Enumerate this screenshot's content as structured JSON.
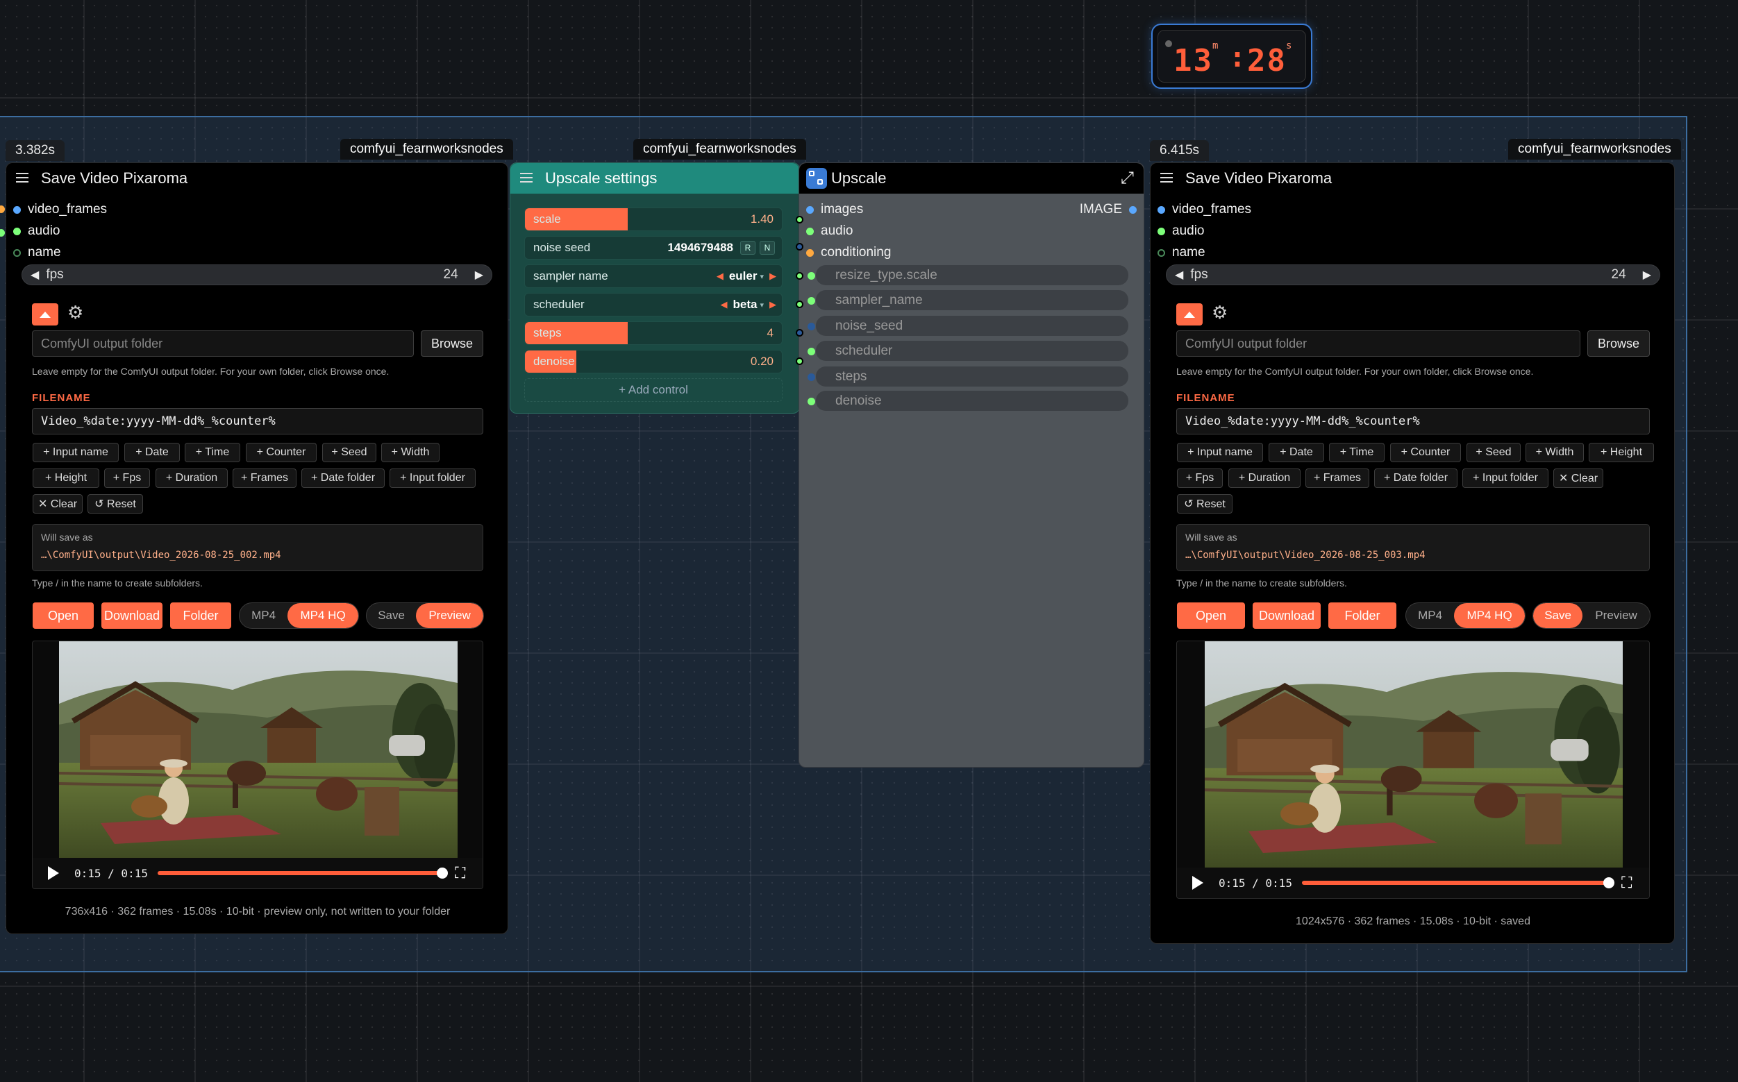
{
  "timer": {
    "minutes": "13",
    "min_unit": "m",
    "seconds": "28",
    "sec_unit": "s"
  },
  "left_node": {
    "time_badge": "3.382s",
    "source_badge": "comfyui_fearnworksnodes",
    "title": "Save Video Pixaroma",
    "inputs": [
      "video_frames",
      "audio",
      "name"
    ],
    "fps_label": "fps",
    "fps_value": "24",
    "folder_placeholder": "ComfyUI output folder",
    "browse_label": "Browse",
    "folder_hint": "Leave empty for the ComfyUI output folder. For your own folder, click Browse once.",
    "filename_label": "FILENAME",
    "filename_value": "Video_%date:yyyy-MM-dd%_%counter%",
    "chips_row1": [
      "+ Input name",
      "+ Date",
      "+ Time",
      "+ Counter",
      "+ Seed",
      "+ Width"
    ],
    "chips_row2": [
      "+ Height",
      "+ Fps",
      "+ Duration",
      "+ Frames",
      "+ Date folder",
      "+ Input folder"
    ],
    "chips_row3": [
      "✕ Clear",
      "↺ Reset"
    ],
    "will_save_label": "Will save as",
    "will_save_path": "…\\ComfyUI\\output\\Video_2026-08-25_002.mp4",
    "subfolder_hint": "Type / in the name to create subfolders.",
    "open": "Open",
    "download": "Download",
    "folder": "Folder",
    "fmt_mp4": "MP4",
    "fmt_mp4hq": "MP4 HQ",
    "mode_save": "Save",
    "mode_preview": "Preview",
    "video_time": "0:15 / 0:15",
    "video_progress": 1.0,
    "meta": "736x416 · 362 frames · 15.08s · 10-bit · preview only, not written to your folder"
  },
  "right_node": {
    "time_badge": "6.415s",
    "source_badge": "comfyui_fearnworksnodes",
    "title": "Save Video Pixaroma",
    "inputs": [
      "video_frames",
      "audio",
      "name"
    ],
    "fps_label": "fps",
    "fps_value": "24",
    "folder_placeholder": "ComfyUI output folder",
    "browse_label": "Browse",
    "folder_hint": "Leave empty for the ComfyUI output folder. For your own folder, click Browse once.",
    "filename_label": "FILENAME",
    "filename_value": "Video_%date:yyyy-MM-dd%_%counter%",
    "chips_row1": [
      "+ Input name",
      "+ Date",
      "+ Time",
      "+ Counter",
      "+ Seed",
      "+ Width",
      "+ Height"
    ],
    "chips_row2": [
      "+ Fps",
      "+ Duration",
      "+ Frames",
      "+ Date folder",
      "+ Input folder",
      "✕ Clear"
    ],
    "chips_row3": [
      "↺ Reset"
    ],
    "will_save_label": "Will save as",
    "will_save_path": "…\\ComfyUI\\output\\Video_2026-08-25_003.mp4",
    "subfolder_hint": "Type / in the name to create subfolders.",
    "open": "Open",
    "download": "Download",
    "folder": "Folder",
    "fmt_mp4": "MP4",
    "fmt_mp4hq": "MP4 HQ",
    "mode_save": "Save",
    "mode_preview": "Preview",
    "video_time": "0:15 / 0:15",
    "video_progress": 1.0,
    "meta": "1024x576 · 362 frames · 15.08s · 10-bit · saved"
  },
  "settings_node": {
    "source_badge": "comfyui_fearnworksnodes",
    "title": "Upscale settings",
    "scale_label": "scale",
    "scale_value": "1.40",
    "scale_fill": 0.4,
    "noise_seed_label": "noise seed",
    "noise_seed_value": "1494679488",
    "r_btn": "R",
    "n_btn": "N",
    "sampler_label": "sampler name",
    "sampler_value": "euler",
    "scheduler_label": "scheduler",
    "scheduler_value": "beta",
    "steps_label": "steps",
    "steps_value": "4",
    "steps_fill": 0.4,
    "denoise_label": "denoise",
    "denoise_value": "0.20",
    "denoise_fill": 0.2,
    "add_control": "+ Add control"
  },
  "upscale_node": {
    "title": "Upscale",
    "inputs": [
      "images",
      "audio",
      "conditioning"
    ],
    "output": "IMAGE",
    "widgets": [
      "resize_type.scale",
      "sampler_name",
      "noise_seed",
      "scheduler",
      "steps",
      "denoise"
    ]
  },
  "colors": {
    "accent": "#ff6a45",
    "teal": "#1f8a7d",
    "blue": "#3a7bd5"
  }
}
